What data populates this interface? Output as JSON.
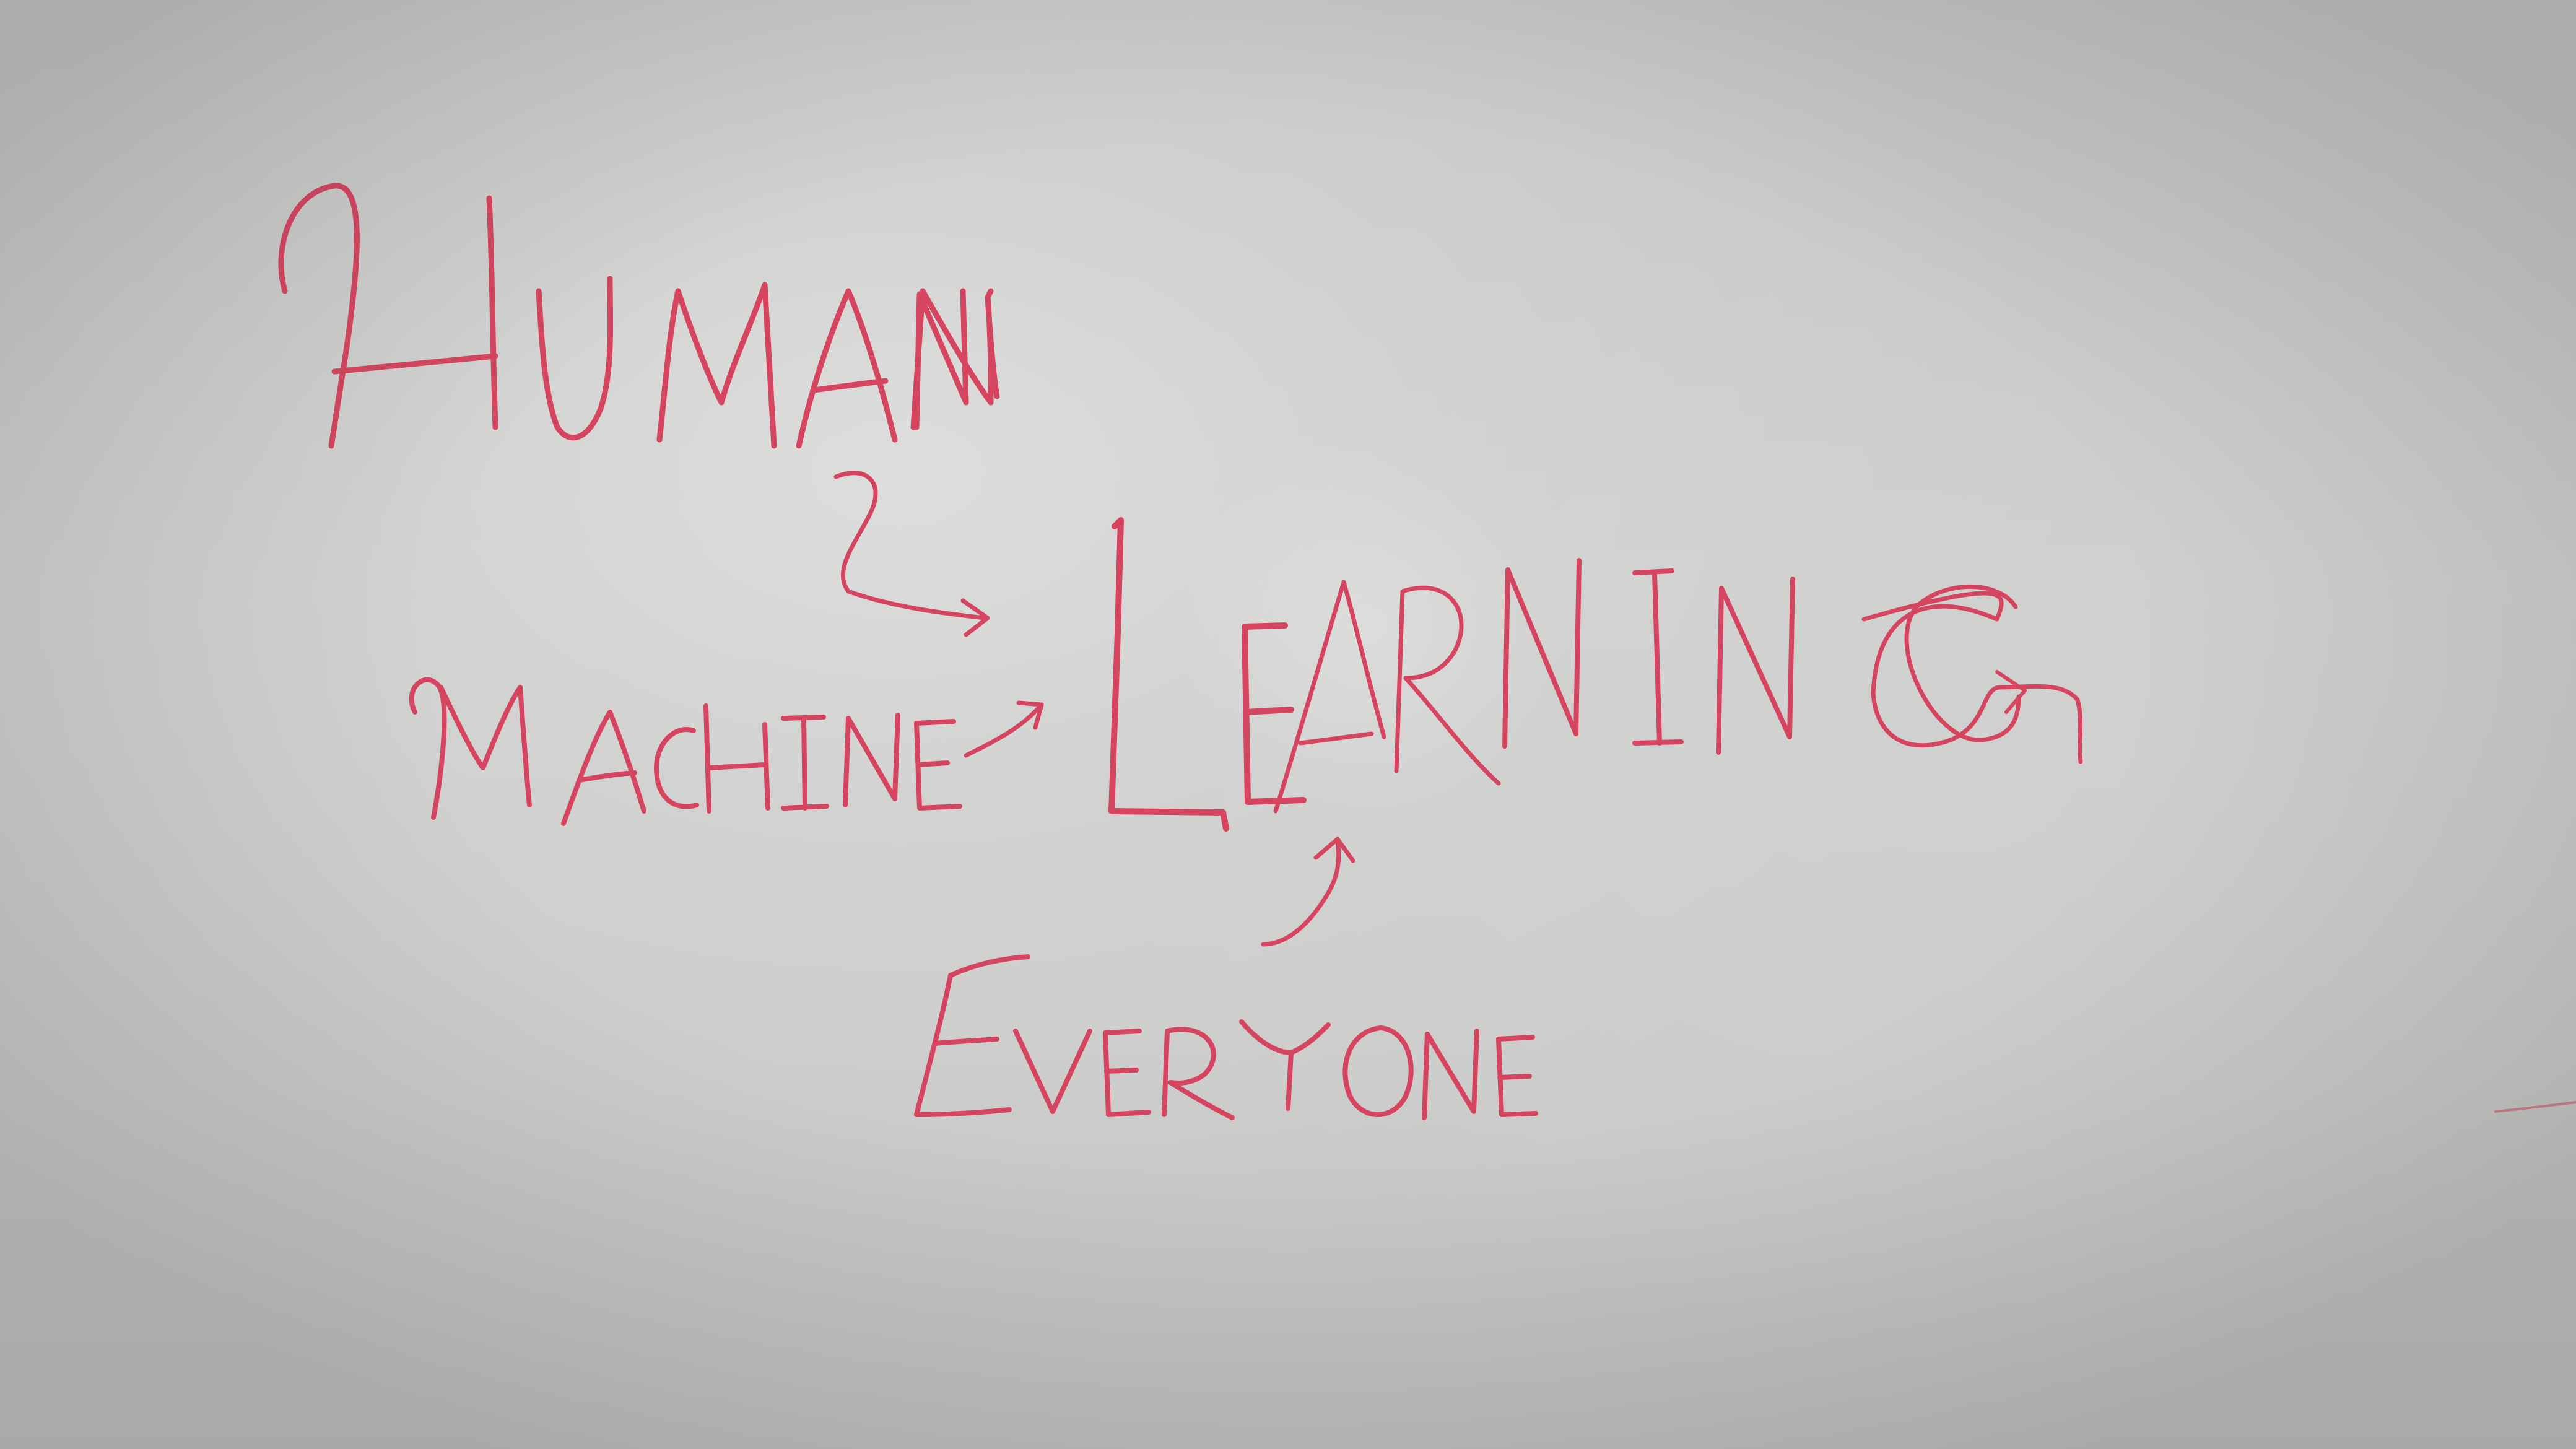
{
  "whiteboard": {
    "ink_color": "#d6455f",
    "words": {
      "human": "HUMAN",
      "machine": "MACHINE",
      "learning": "LEARNING",
      "everyone": "EVERYONE"
    }
  }
}
